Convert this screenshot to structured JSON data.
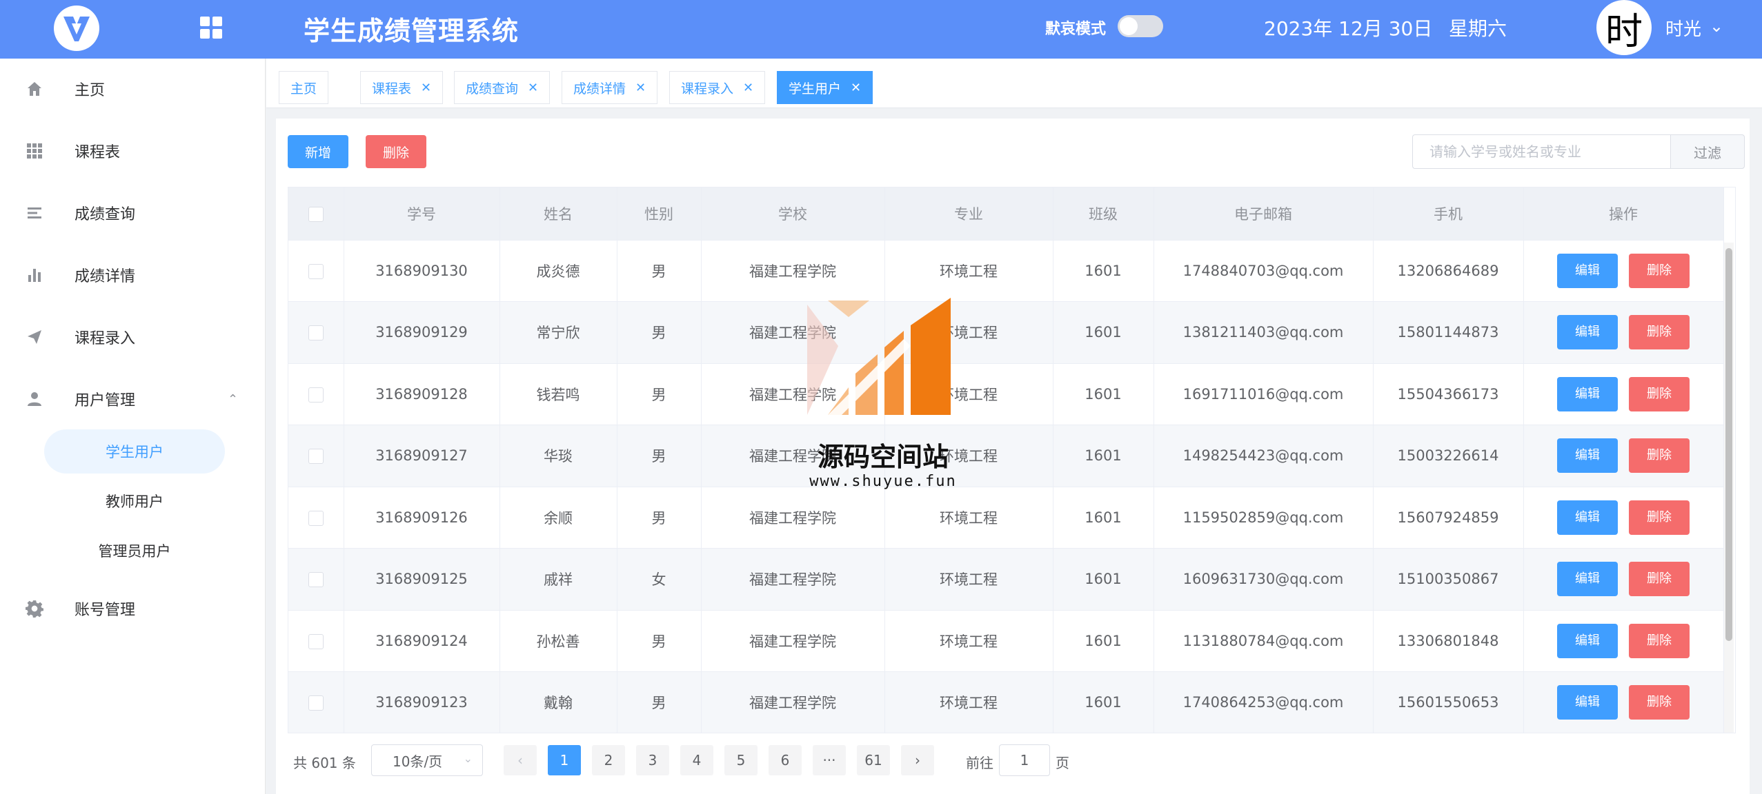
{
  "header": {
    "app_title": "学生成绩管理系统",
    "theme_label": "默哀模式",
    "date": "2023年 12月 30日",
    "weekday": "星期六",
    "avatar_char": "时",
    "username": "时光",
    "colors": {
      "header_bg": "#5b8ff9"
    }
  },
  "sidebar": {
    "items": [
      {
        "label": "主页",
        "icon": "home-icon"
      },
      {
        "label": "课程表",
        "icon": "grid-icon"
      },
      {
        "label": "成绩查询",
        "icon": "list-icon"
      },
      {
        "label": "成绩详情",
        "icon": "bar-chart-icon"
      },
      {
        "label": "课程录入",
        "icon": "send-icon"
      },
      {
        "label": "用户管理",
        "icon": "user-icon",
        "expanded": true
      },
      {
        "label": "账号管理",
        "icon": "gear-icon"
      }
    ],
    "sub_items": [
      {
        "label": "学生用户",
        "active": true
      },
      {
        "label": "教师用户",
        "active": false
      },
      {
        "label": "管理员用户",
        "active": false
      }
    ]
  },
  "tabs": [
    {
      "label": "主页",
      "closable": false,
      "active": false
    },
    {
      "label": "课程表",
      "closable": true,
      "active": false
    },
    {
      "label": "成绩查询",
      "closable": true,
      "active": false
    },
    {
      "label": "成绩详情",
      "closable": true,
      "active": false
    },
    {
      "label": "课程录入",
      "closable": true,
      "active": false
    },
    {
      "label": "学生用户",
      "closable": true,
      "active": true
    }
  ],
  "toolbar": {
    "add_label": "新增",
    "delete_label": "删除",
    "search_placeholder": "请输入学号或姓名或专业",
    "filter_label": "过滤"
  },
  "table": {
    "columns": [
      "学号",
      "姓名",
      "性别",
      "学校",
      "专业",
      "班级",
      "电子邮箱",
      "手机",
      "操作"
    ],
    "edit_label": "编辑",
    "delete_label": "删除",
    "rows": [
      [
        "3168909130",
        "成炎德",
        "男",
        "福建工程学院",
        "环境工程",
        "1601",
        "1748840703@qq.com",
        "13206864689"
      ],
      [
        "3168909129",
        "常宁欣",
        "男",
        "福建工程学院",
        "环境工程",
        "1601",
        "1381211403@qq.com",
        "15801144873"
      ],
      [
        "3168909128",
        "钱若鸣",
        "男",
        "福建工程学院",
        "环境工程",
        "1601",
        "1691711016@qq.com",
        "15504366173"
      ],
      [
        "3168909127",
        "华琰",
        "男",
        "福建工程学院",
        "环境工程",
        "1601",
        "1498254423@qq.com",
        "15003226614"
      ],
      [
        "3168909126",
        "余顺",
        "男",
        "福建工程学院",
        "环境工程",
        "1601",
        "1159502859@qq.com",
        "15607924859"
      ],
      [
        "3168909125",
        "戚祥",
        "女",
        "福建工程学院",
        "环境工程",
        "1601",
        "1609631730@qq.com",
        "15100350867"
      ],
      [
        "3168909124",
        "孙松善",
        "男",
        "福建工程学院",
        "环境工程",
        "1601",
        "1131880784@qq.com",
        "13306801848"
      ],
      [
        "3168909123",
        "戴翰",
        "男",
        "福建工程学院",
        "环境工程",
        "1601",
        "1740864253@qq.com",
        "15601550653"
      ]
    ]
  },
  "pagination": {
    "total": "共 601 条",
    "page_size": "10条/页",
    "pages": [
      "1",
      "2",
      "3",
      "4",
      "5",
      "6",
      "···",
      "61"
    ],
    "current": "1",
    "goto_label": "前往",
    "goto_value": "1",
    "page_suffix": "页"
  },
  "watermark": {
    "text": "源码空间站",
    "url": "www.shuyue.fun"
  }
}
